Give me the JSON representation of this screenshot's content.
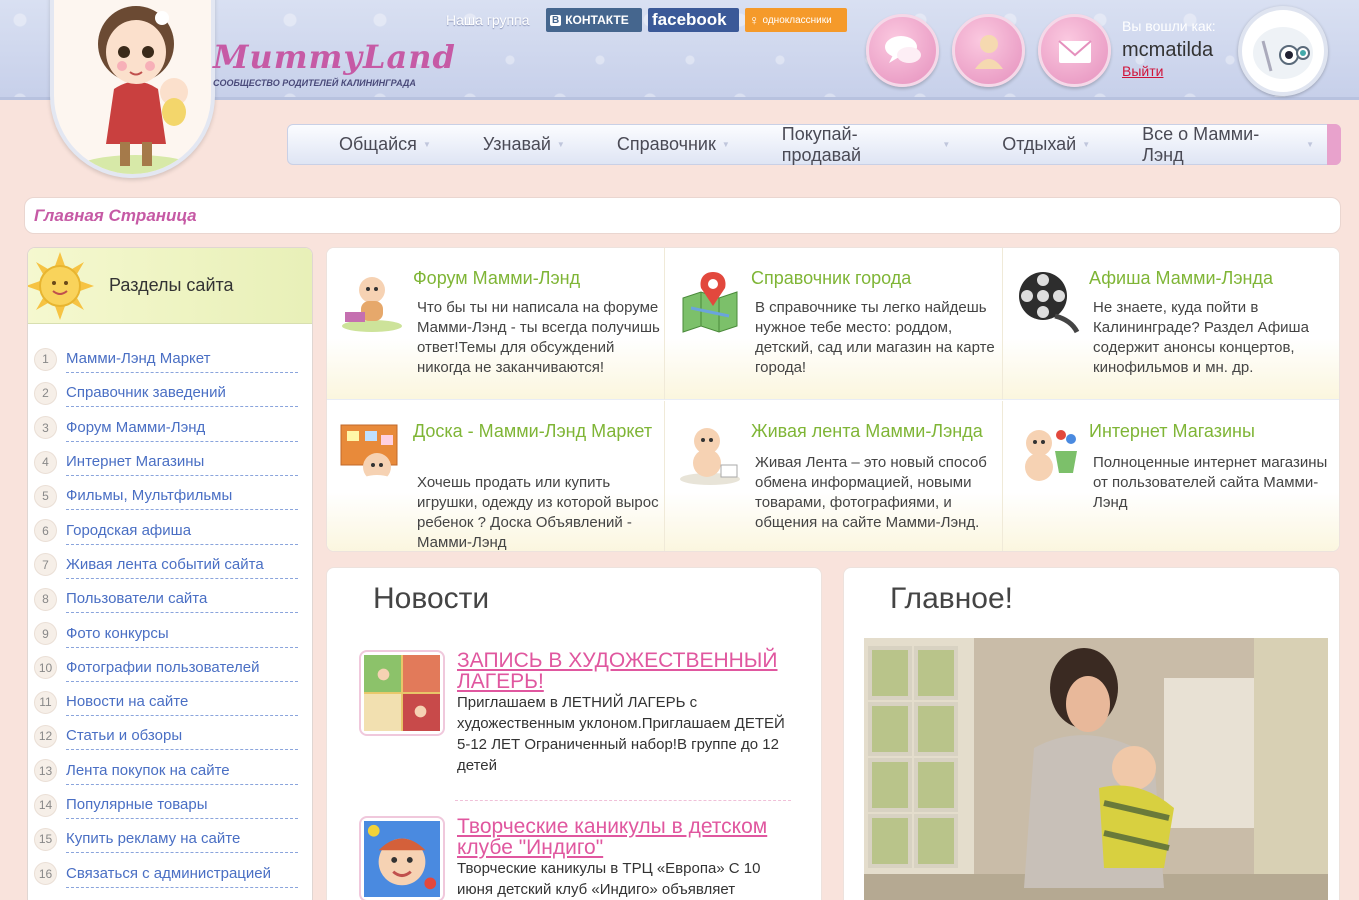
{
  "header": {
    "brand": "MummyLand",
    "tagline": "СООБЩЕСТВО РОДИТЕЛЕЙ КАЛИНИНГРАДА",
    "group_label": "Наша группа",
    "social": [
      {
        "label": "КОНТАКТЕ",
        "badge": "В",
        "icon": "vkontakte-icon",
        "color": "#45668e"
      },
      {
        "label": "facebook",
        "icon": "facebook-icon",
        "color": "#3b5998"
      },
      {
        "label": "одноклассники",
        "icon": "odnoklassniki-icon",
        "color": "#f59a2a"
      }
    ],
    "round_buttons": [
      "messages-icon",
      "user-icon",
      "mail-icon"
    ],
    "login_label": "Вы вошли как:",
    "username": "mcmatilda",
    "logout": "Выйти"
  },
  "nav": {
    "items": [
      {
        "label": "Общайся"
      },
      {
        "label": "Узнавай"
      },
      {
        "label": "Справочник"
      },
      {
        "label": "Покупай-продавай"
      },
      {
        "label": "Отдыхай"
      },
      {
        "label": "Все о Мамми-Лэнд"
      }
    ]
  },
  "breadcrumb": {
    "label": "Главная Страница"
  },
  "sidebar": {
    "title": "Разделы сайта",
    "items": [
      {
        "num": "1",
        "label": "Мамми-Лэнд Маркет"
      },
      {
        "num": "2",
        "label": "Справочник заведений"
      },
      {
        "num": "3",
        "label": "Форум Мамми-Лэнд"
      },
      {
        "num": "4",
        "label": "Интернет Магазины"
      },
      {
        "num": "5",
        "label": "Фильмы, Мультфильмы"
      },
      {
        "num": "6",
        "label": "Городская афиша"
      },
      {
        "num": "7",
        "label": "Живая лента событий сайта"
      },
      {
        "num": "8",
        "label": "Пользователи сайта"
      },
      {
        "num": "9",
        "label": "Фото конкурсы"
      },
      {
        "num": "10",
        "label": "Фотографии пользователей"
      },
      {
        "num": "11",
        "label": "Новости на сайте"
      },
      {
        "num": "12",
        "label": "Статьи и обзоры"
      },
      {
        "num": "13",
        "label": "Лента покупок на сайте"
      },
      {
        "num": "14",
        "label": "Популярные товары"
      },
      {
        "num": "15",
        "label": "Купить рекламу на сайте"
      },
      {
        "num": "16",
        "label": "Связаться с администрацией"
      }
    ]
  },
  "features": [
    {
      "title": "Форум Мамми-Лэнд",
      "desc": "Что бы ты ни написала на форуме Мамми-Лэнд - ты всегда получишь ответ!Темы для обсуждений никогда не заканчиваются!",
      "icon": "forum-baby-icon"
    },
    {
      "title": "Справочник города",
      "desc": "В справочнике ты легко найдешь нужное тебе место: роддом, детский, сад или магазин на карте города!",
      "icon": "map-pin-icon"
    },
    {
      "title": "Афиша Мамми-Лэнда",
      "desc": "Не знаете, куда пойти в Калининграде? Раздел Афиша содержит анонсы концертов, кинофильмов и мн. др.",
      "icon": "film-reel-icon"
    },
    {
      "title": "Доска - Мамми-Лэнд Маркет",
      "desc": "Хочешь продать или купить игрушки, одежду из которой вырос ребенок ? Доска Объявлений - Мамми-Лэнд",
      "icon": "board-baby-icon"
    },
    {
      "title": "Живая лента Мамми-Лэнда",
      "desc": "Живая Лента – это новый способ обмена информацией, новыми товарами, фотографиями, и общения на сайте Мамми-Лэнд.",
      "icon": "baby-feed-icon"
    },
    {
      "title": "Интернет Магазины",
      "desc": "Полноценные интернет магазины от пользователей сайта Мамми-Лэнд",
      "icon": "shop-baby-icon"
    }
  ],
  "news": {
    "title": "Новости",
    "items": [
      {
        "title": "ЗАПИСЬ В ХУДОЖЕСТВЕННЫЙ ЛАГЕРЬ!",
        "text": "Приглашаем в ЛЕТНИЙ ЛАГЕРЬ с художественным уклоном.Приглашаем  ДЕТЕЙ 5-12 ЛЕТ Ограниченный набор!В группе до 12 детей"
      },
      {
        "title": "Творческие каникулы в детском клубе \"Индиго\"",
        "text": "Творческие каникулы в ТРЦ «Европа» С 10 июня детский клуб «Индиго» объявляет"
      }
    ]
  },
  "main": {
    "title": "Главное!"
  }
}
